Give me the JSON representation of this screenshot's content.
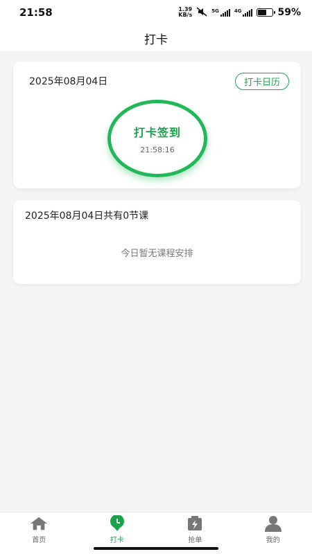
{
  "status_bar": {
    "time": "21:58",
    "net_speed_value": "1.39",
    "net_speed_unit": "KB/s",
    "signal1_label": "5G",
    "signal2_label": "4G",
    "battery_level": 0.59,
    "battery_percent": "59%"
  },
  "nav": {
    "title": "打卡"
  },
  "checkin_card": {
    "date": "2025年08月04日",
    "calendar_button": "打卡日历",
    "checkin_button": "打卡签到",
    "current_time": "21:58:16"
  },
  "course_card": {
    "header": "2025年08月04日共有0节课",
    "empty_text": "今日暂无课程安排"
  },
  "tabs": [
    {
      "label": "首页",
      "icon": "home-icon",
      "active": false
    },
    {
      "label": "打卡",
      "icon": "clock-pin-icon",
      "active": true
    },
    {
      "label": "抢单",
      "icon": "lightning-icon",
      "active": false
    },
    {
      "label": "我的",
      "icon": "person-icon",
      "active": false
    }
  ],
  "colors": {
    "accent": "#1aa34a",
    "ring": "#22b85a",
    "inactive": "#777777"
  }
}
